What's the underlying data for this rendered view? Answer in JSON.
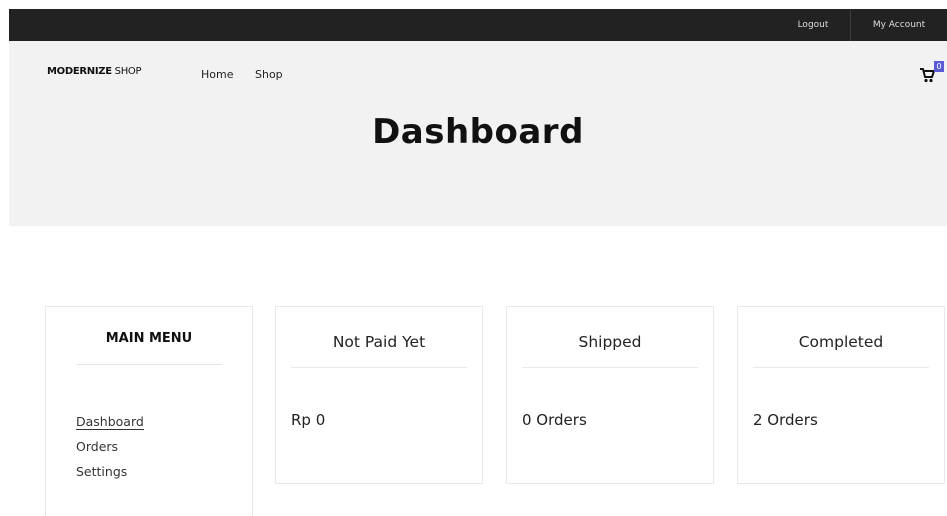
{
  "topbar": {
    "logout_label": "Logout",
    "account_label": "My Account"
  },
  "header": {
    "logo_bold": "MODERNIZE",
    "logo_rest": " SHOP",
    "nav": [
      {
        "label": "Home"
      },
      {
        "label": "Shop"
      }
    ],
    "cart_count": "0"
  },
  "page_title": "Dashboard",
  "sidebar": {
    "title": "MAIN MENU",
    "items": [
      {
        "label": "Dashboard",
        "active": true
      },
      {
        "label": "Orders"
      },
      {
        "label": "Settings"
      }
    ]
  },
  "stats": [
    {
      "title": "Not Paid Yet",
      "value": "Rp 0"
    },
    {
      "title": "Shipped",
      "value": "0 Orders"
    },
    {
      "title": "Completed",
      "value": "2 Orders"
    }
  ],
  "colors": {
    "topbar": "#222222",
    "hero": "#f2f2f2",
    "cart_badge": "#5b5bd6"
  }
}
